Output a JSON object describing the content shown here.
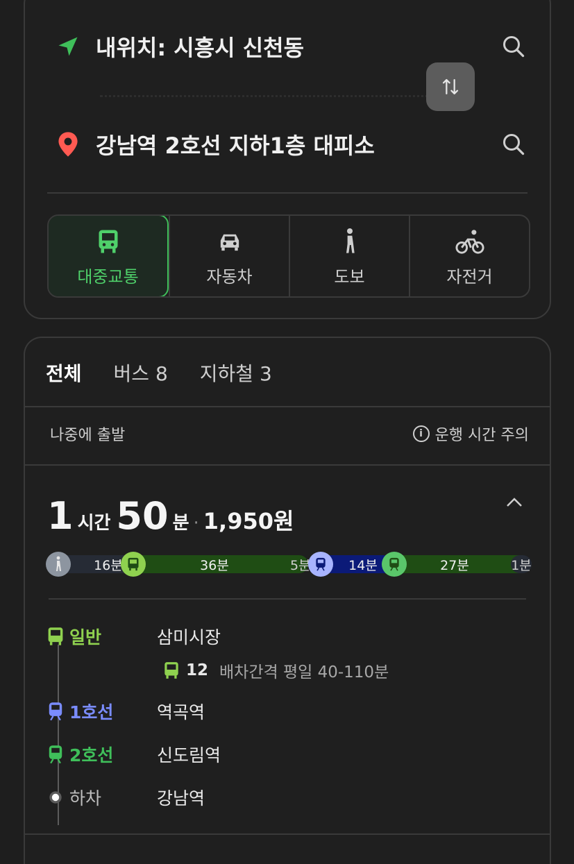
{
  "search": {
    "origin": "내위치: 시흥시 신천동",
    "destination": "강남역 2호선 지하1층 대피소"
  },
  "modes": [
    {
      "label": "대중교통",
      "icon": "bus-icon",
      "active": true
    },
    {
      "label": "자동차",
      "icon": "car-icon",
      "active": false
    },
    {
      "label": "도보",
      "icon": "walk-icon",
      "active": false
    },
    {
      "label": "자전거",
      "icon": "bicycle-icon",
      "active": false
    }
  ],
  "results": {
    "tabs": [
      {
        "label": "전체",
        "active": true
      },
      {
        "label": "버스 8",
        "active": false
      },
      {
        "label": "지하철 3",
        "active": false
      }
    ],
    "depart_later": "나중에 출발",
    "notice": "운행 시간 주의",
    "route": {
      "hours": "1",
      "hours_unit": "시간",
      "minutes": "50",
      "minutes_unit": "분",
      "separator": "·",
      "fare": "1,950원",
      "segments": {
        "walk1": "16분",
        "bus": "36분",
        "transfer_walk": "5분",
        "subway1": "14분",
        "subway2": "27분",
        "walk2": "1분"
      },
      "steps": [
        {
          "mode": "일반",
          "place": "삼미시장",
          "color": "#8fd14f"
        },
        {
          "mode": "1호선",
          "place": "역곡역",
          "color": "#7a8cff"
        },
        {
          "mode": "2호선",
          "place": "신도림역",
          "color": "#3fbf5a"
        },
        {
          "mode": "하차",
          "place": "강남역",
          "color": "#bdbdbd"
        }
      ],
      "bus_route": "12",
      "bus_interval": "배차간격 평일 40-110분"
    }
  }
}
